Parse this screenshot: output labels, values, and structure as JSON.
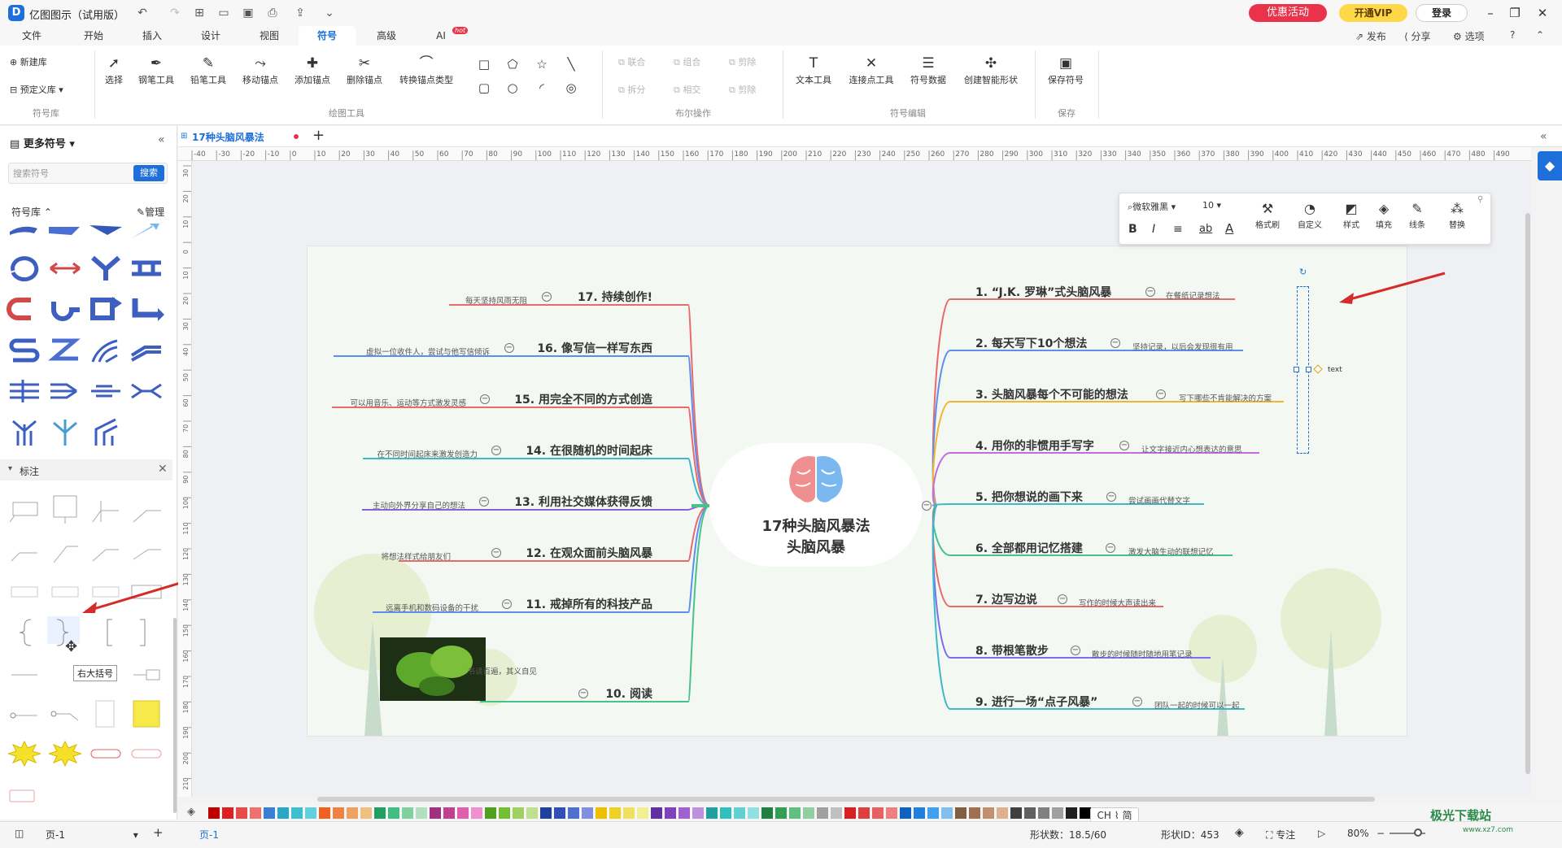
{
  "window": {
    "title": "亿图图示（试用版）",
    "logo": "D",
    "promo": "优惠活动",
    "vip": "开通VIP",
    "login": "登录"
  },
  "menu": [
    "文件",
    "开始",
    "插入",
    "设计",
    "视图",
    "符号",
    "高级",
    "AI"
  ],
  "ai_badge": "hot",
  "right_menu": {
    "publish": "发布",
    "share": "分享",
    "options": "选项"
  },
  "ribbon": {
    "library": {
      "new": "新建库",
      "preset": "预定义库",
      "group": "符号库"
    },
    "draw": [
      "选择",
      "钢笔工具",
      "铅笔工具",
      "移动锚点",
      "添加锚点",
      "删除锚点",
      "转换锚点类型"
    ],
    "draw_group": "绘图工具",
    "bool": [
      "联合",
      "组合",
      "剪除",
      "拆分",
      "相交",
      "剪除"
    ],
    "bool_group": "布尔操作",
    "edit": [
      "文本工具",
      "连接点工具",
      "符号数据",
      "创建智能形状"
    ],
    "edit_group": "符号编辑",
    "save": "保存符号",
    "save_group": "保存"
  },
  "left_panel": {
    "title": "更多符号",
    "search_placeholder": "搜索符号",
    "search_btn": "搜索",
    "lib_label": "符号库",
    "manage": "管理",
    "section": "标注",
    "tooltip": "右大括号"
  },
  "doc": {
    "tab": "17种头脑风暴法"
  },
  "ruler": {
    "h": [
      "-40",
      "-30",
      "-20",
      "-10",
      "0",
      "10",
      "20",
      "30",
      "40",
      "50",
      "60",
      "70",
      "80",
      "90",
      "100",
      "110",
      "120",
      "130",
      "140",
      "150",
      "160",
      "170",
      "180",
      "190",
      "200",
      "210",
      "220",
      "230",
      "240",
      "250",
      "260",
      "270",
      "280",
      "290",
      "300",
      "310",
      "320",
      "330",
      "340",
      "350",
      "360",
      "370",
      "380",
      "390",
      "400",
      "410",
      "420",
      "430",
      "440",
      "450",
      "460",
      "470",
      "480",
      "490"
    ],
    "v": [
      "30",
      "20",
      "10",
      "0",
      "10",
      "20",
      "30",
      "40",
      "50",
      "60",
      "70",
      "80",
      "90",
      "100",
      "110",
      "120",
      "130",
      "140",
      "150",
      "160",
      "170",
      "180",
      "190",
      "200",
      "210"
    ]
  },
  "mindmap": {
    "center": [
      "17种头脑风暴法",
      "头脑风暴"
    ],
    "right": [
      {
        "title": "1. “J.K. 罗琳”式头脑风暴",
        "note": "在餐纸记录想法",
        "color": "#e86a6a"
      },
      {
        "title": "2. 每天写下10个想法",
        "note": "坚持记录，以后会发现很有用",
        "color": "#5b8ef0"
      },
      {
        "title": "3. 头脑风暴每个不可能的想法",
        "note": "写下哪些不肯能解决的方案",
        "color": "#f2b531"
      },
      {
        "title": "4. 用你的非惯用手写字",
        "note": "让文字接近内心想表达的意思",
        "color": "#c56be0"
      },
      {
        "title": "5. 把你想说的画下来",
        "note": "尝试画画代替文字",
        "color": "#3fb8c9"
      },
      {
        "title": "6. 全部都用记忆搭建",
        "note": "激发大脑生动的联想记忆",
        "color": "#48c28a"
      },
      {
        "title": "7. 边写边说",
        "note": "写作的时候大声读出来",
        "color": "#e86a6a"
      },
      {
        "title": "8. 带根笔散步",
        "note": "散步的时候随时随地用笔记录",
        "color": "#7c6ef0"
      },
      {
        "title": "9. 进行一场“点子风暴”",
        "note": "团队一起的时候可以一起",
        "color": "#3fb8c9"
      }
    ],
    "left": [
      {
        "title": "17. 持续创作!",
        "note": "每天坚持风雨无阻",
        "color": "#e86a6a"
      },
      {
        "title": "16. 像写信一样写东西",
        "note": "虚拟一位收件人，尝试与他写信倾诉",
        "color": "#5b8ef0"
      },
      {
        "title": "15. 用完全不同的方式创造",
        "note": "可以用音乐、运动等方式激发灵感",
        "color": "#e86a6a"
      },
      {
        "title": "14. 在很随机的时间起床",
        "note": "在不同时间起床来激发创造力",
        "color": "#3fb8c9"
      },
      {
        "title": "13. 利用社交媒体获得反馈",
        "note": "主动向外界分享自己的想法",
        "color": "#8e5ee0"
      },
      {
        "title": "12. 在观众面前头脑风暴",
        "note": "将想法样式给朋友们",
        "color": "#e86a6a"
      },
      {
        "title": "11. 戒掉所有的科技产品",
        "note": "远离手机和数码设备的干扰",
        "color": "#5b8ef0"
      },
      {
        "title": "10. 阅读",
        "note": "书读百遍，其义自见",
        "color": "#48c28a"
      }
    ],
    "selected_text": "text"
  },
  "float_toolbar": {
    "font": "微软雅黑",
    "size": "10",
    "buttons": [
      "格式刷",
      "自定义",
      "样式",
      "填充",
      "线条",
      "替换"
    ]
  },
  "status": {
    "page_label": "页-1",
    "page_tab": "页-1",
    "shape_count": "形状数：18.5/60",
    "shape_id": "形状ID：453",
    "focus": "专注",
    "zoom": "80%",
    "ime": "CH ⌇ 简"
  },
  "watermark": "极光下载站",
  "watermark_url": "www.xz7.com",
  "colors": {
    "accent": "#1e6fd9",
    "promo": "#e8334a",
    "vip": "#ffd84a"
  }
}
